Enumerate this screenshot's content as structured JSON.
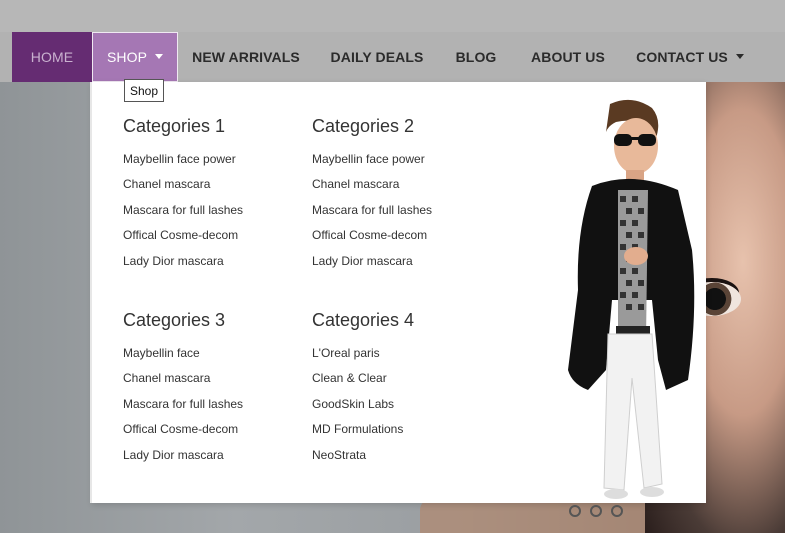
{
  "nav": {
    "items": [
      {
        "label": "HOME"
      },
      {
        "label": "SHOP"
      },
      {
        "label": "NEW ARRIVALS"
      },
      {
        "label": "DAILY DEALS"
      },
      {
        "label": "BLOG"
      },
      {
        "label": "ABOUT US"
      },
      {
        "label": "CONTACT US"
      }
    ]
  },
  "tooltip": "Shop",
  "mega_menu": {
    "columns": [
      {
        "title": "Categories 1",
        "links": [
          "Maybellin face power",
          "Chanel mascara",
          "Mascara for full lashes",
          "Offical Cosme-decom",
          "Lady Dior mascara"
        ]
      },
      {
        "title": "Categories 2",
        "links": [
          "Maybellin face power",
          "Chanel mascara",
          "Mascara for full lashes",
          "Offical Cosme-decom",
          "Lady Dior mascara"
        ]
      },
      {
        "title": "Categories 3",
        "links": [
          "Maybellin face",
          "Chanel mascara",
          "Mascara for full lashes",
          "Offical Cosme-decom",
          "Lady Dior mascara"
        ]
      },
      {
        "title": "Categories 4",
        "links": [
          "L'Oreal paris",
          "Clean & Clear",
          "GoodSkin Labs",
          "MD Formulations",
          "NeoStrata"
        ]
      }
    ]
  },
  "carousel": {
    "slides": 3
  },
  "colors": {
    "home_bg": "#652c72",
    "shop_bg": "#a577b4"
  }
}
